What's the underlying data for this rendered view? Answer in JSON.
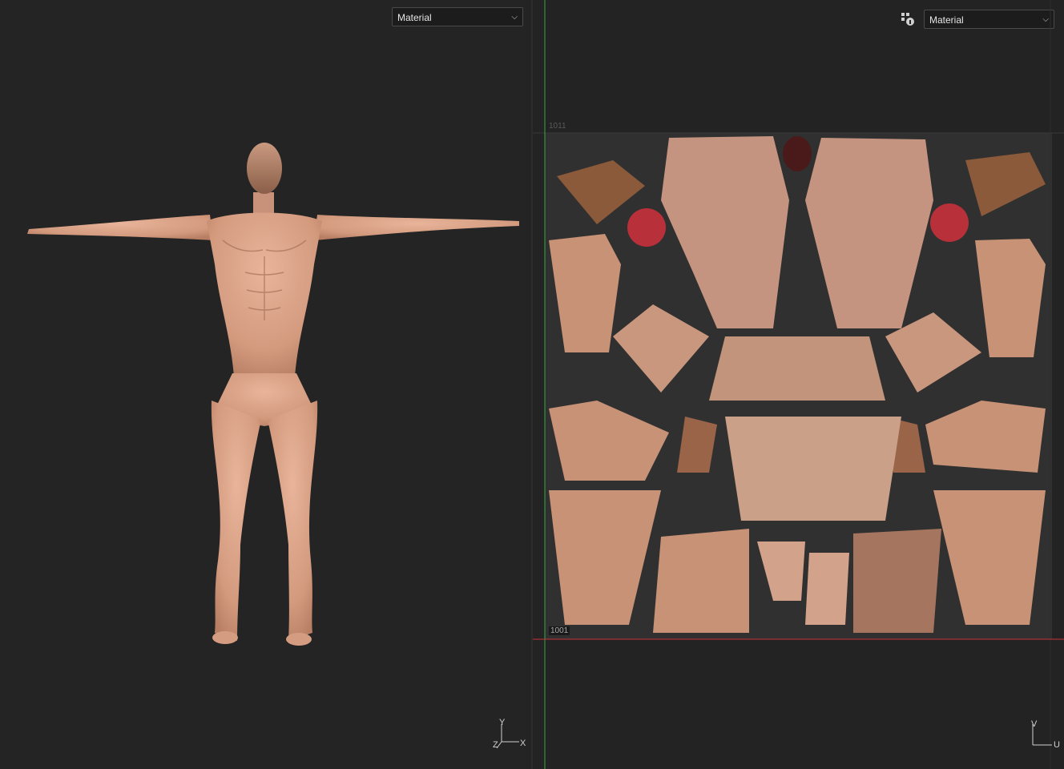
{
  "viewport_3d": {
    "shading_mode": "Material",
    "axis_labels": {
      "y": "Y",
      "z": "Z",
      "x": "X"
    }
  },
  "uv_editor": {
    "shading_mode": "Material",
    "tile_bottom_left": "1001",
    "tile_top_left": "1011",
    "axis_labels": {
      "v": "V",
      "u": "U"
    }
  },
  "colors": {
    "uv_u_axis": "#c8323a",
    "uv_v_axis": "#2fae3c",
    "skin": "#d9a185",
    "background": "#232323"
  }
}
